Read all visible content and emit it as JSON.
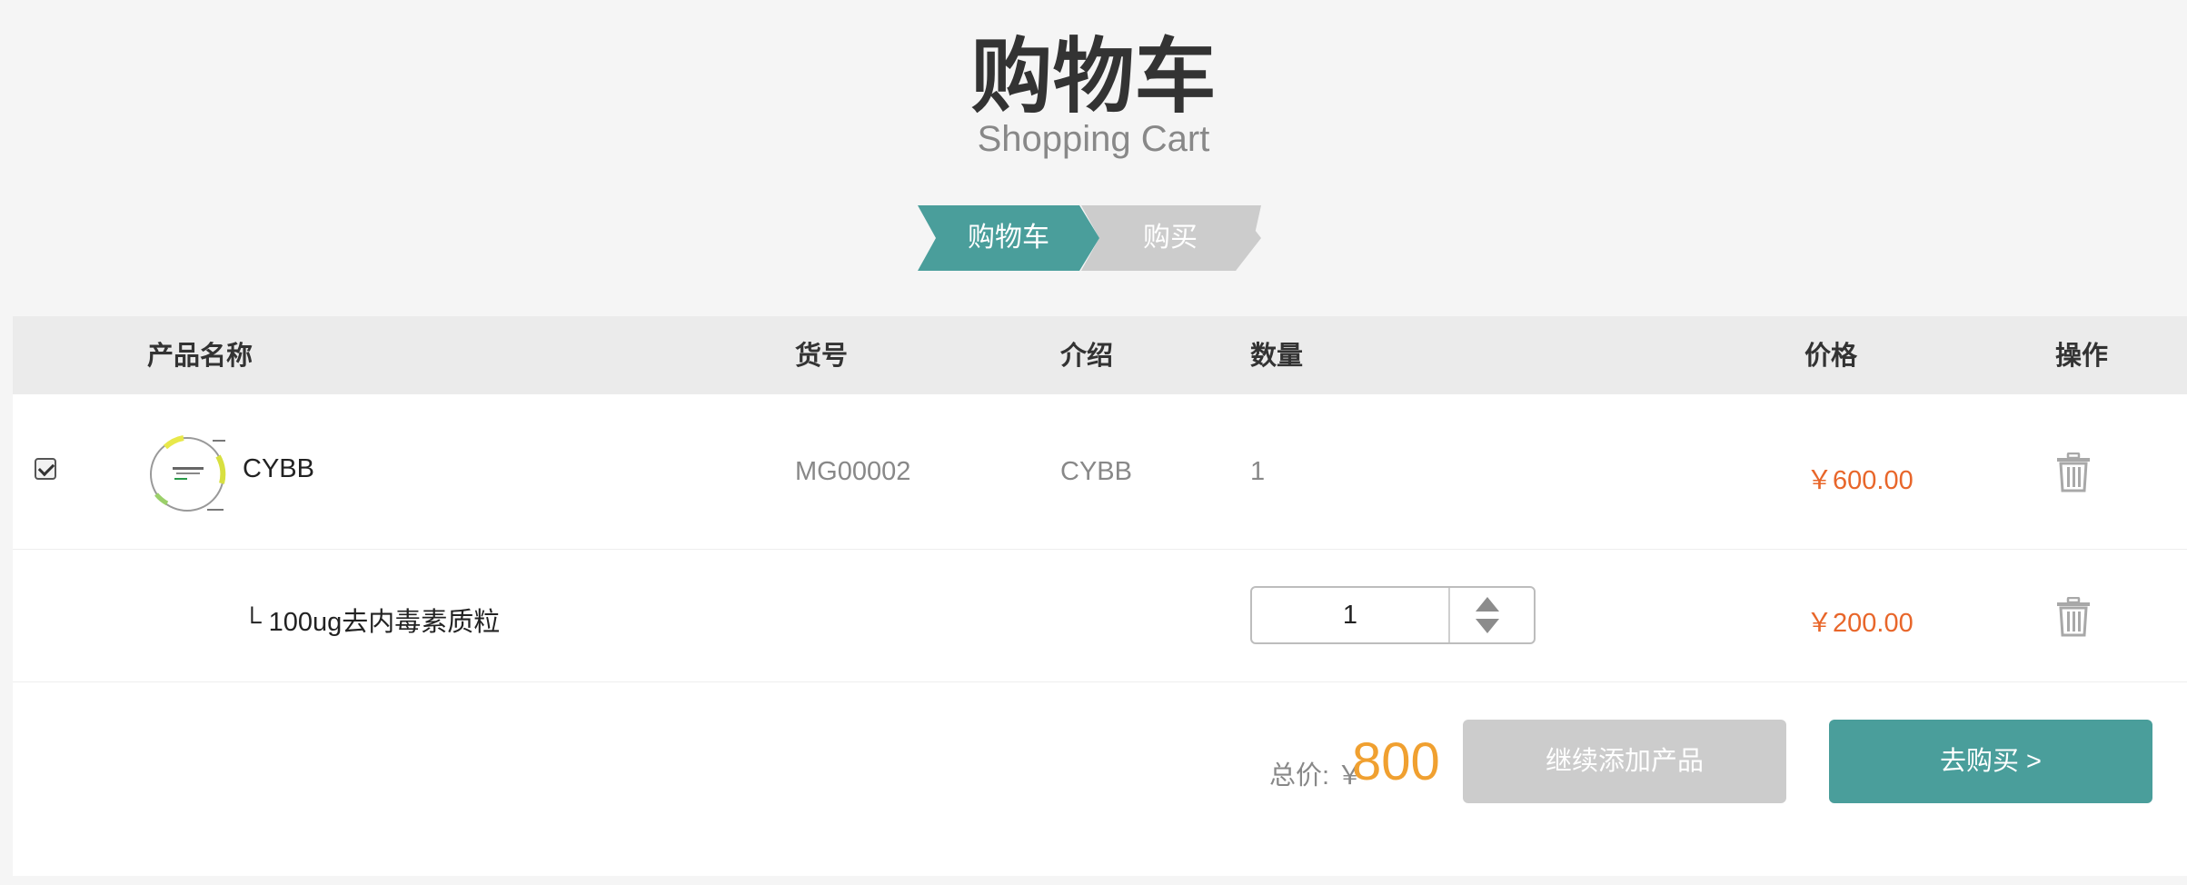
{
  "header": {
    "title_cn": "购物车",
    "title_en": "Shopping Cart"
  },
  "steps": [
    {
      "label": "购物车",
      "active": true
    },
    {
      "label": "购买",
      "active": false
    }
  ],
  "table": {
    "columns": [
      "产品名称",
      "货号",
      "介绍",
      "数量",
      "价格",
      "操作"
    ]
  },
  "items": [
    {
      "checked": true,
      "name": "CYBB",
      "sku": "MG00002",
      "intro": "CYBB",
      "quantity": "1",
      "price": "￥600.00",
      "action_icon": "trash-icon"
    }
  ],
  "sub_items": [
    {
      "name": "└ 100ug去内毒素质粒",
      "quantity": "1",
      "price": "￥200.00",
      "action_icon": "trash-icon"
    }
  ],
  "footer": {
    "total_label": "总价: ￥",
    "total_amount": "800",
    "continue_button": "继续添加产品",
    "checkout_button": "去购买 >"
  },
  "colors": {
    "accent": "#4a9e9b",
    "inactive_step": "#cccccc",
    "price": "#e8662a",
    "total": "#f0a030"
  }
}
